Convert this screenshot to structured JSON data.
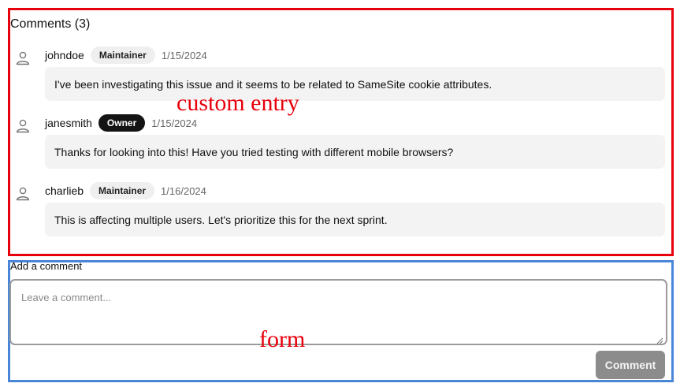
{
  "comments_section": {
    "title": "Comments (3)",
    "items": [
      {
        "author": "johndoe",
        "role": "Maintainer",
        "role_style": "light",
        "date": "1/15/2024",
        "text": "I've been investigating this issue and it seems to be related to SameSite cookie attributes."
      },
      {
        "author": "janesmith",
        "role": "Owner",
        "role_style": "dark",
        "date": "1/15/2024",
        "text": "Thanks for looking into this! Have you tried testing with different mobile browsers?"
      },
      {
        "author": "charlieb",
        "role": "Maintainer",
        "role_style": "light",
        "date": "1/16/2024",
        "text": "This is affecting multiple users. Let's prioritize this for the next sprint."
      }
    ]
  },
  "form": {
    "label": "Add a comment",
    "placeholder": "Leave a comment...",
    "value": "",
    "submit_label": "Comment"
  },
  "annotations": {
    "entry_label": "custom entry",
    "form_label": "form",
    "entry_color": "#e8000b",
    "form_color": "#4a86d8"
  },
  "icons": {
    "avatar": "user-icon"
  }
}
